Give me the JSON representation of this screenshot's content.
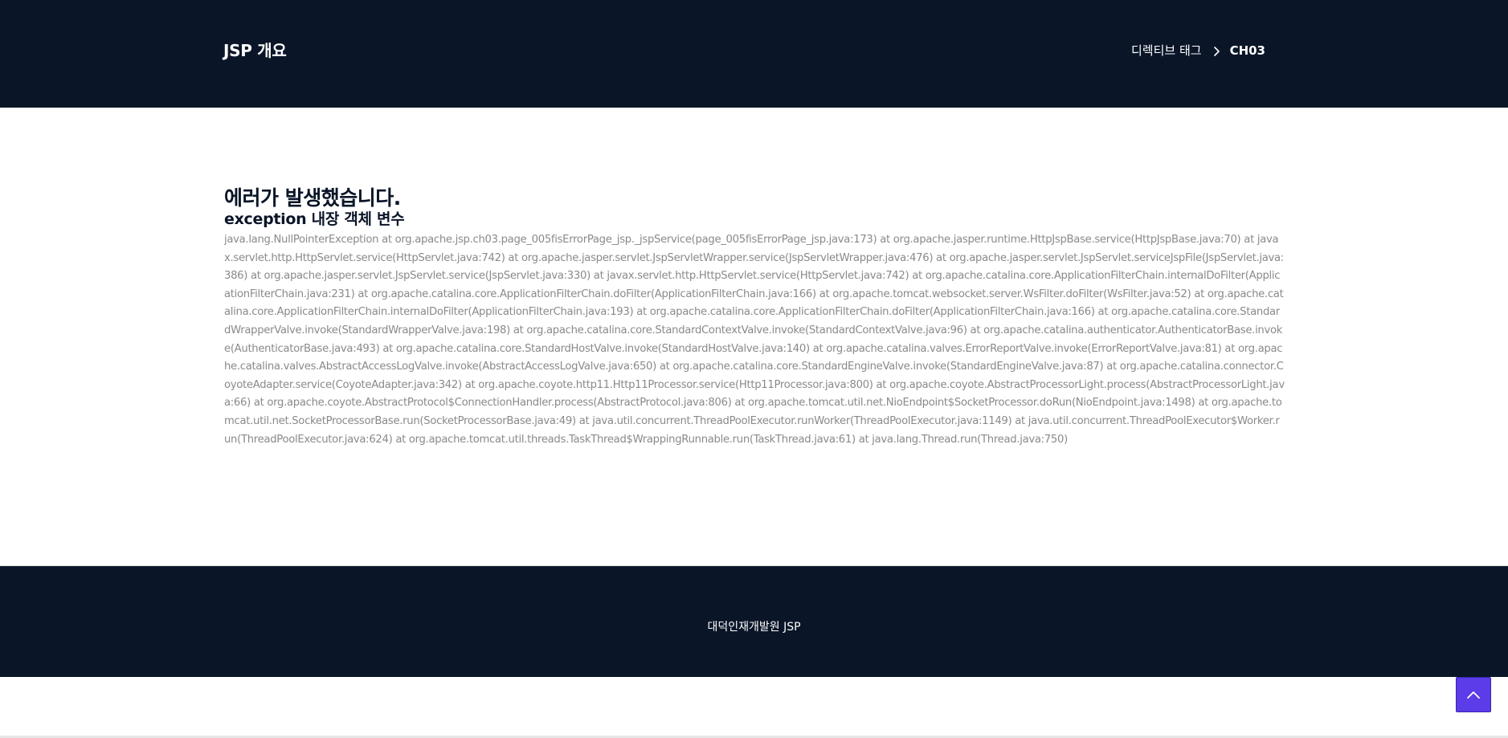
{
  "header": {
    "title": "JSP 개요",
    "breadcrumb": {
      "parent": "디렉티브 태그",
      "current": "CH03"
    }
  },
  "main": {
    "title": "에러가 발생했습니다.",
    "subtitle": "exception 내장 객체 변수",
    "stacktrace": "java.lang.NullPointerException at org.apache.jsp.ch03.page_005fisErrorPage_jsp._jspService(page_005fisErrorPage_jsp.java:173) at org.apache.jasper.runtime.HttpJspBase.service(HttpJspBase.java:70) at javax.servlet.http.HttpServlet.service(HttpServlet.java:742) at org.apache.jasper.servlet.JspServletWrapper.service(JspServletWrapper.java:476) at org.apache.jasper.servlet.JspServlet.serviceJspFile(JspServlet.java:386) at org.apache.jasper.servlet.JspServlet.service(JspServlet.java:330) at javax.servlet.http.HttpServlet.service(HttpServlet.java:742) at org.apache.catalina.core.ApplicationFilterChain.internalDoFilter(ApplicationFilterChain.java:231) at org.apache.catalina.core.ApplicationFilterChain.doFilter(ApplicationFilterChain.java:166) at org.apache.tomcat.websocket.server.WsFilter.doFilter(WsFilter.java:52) at org.apache.catalina.core.ApplicationFilterChain.internalDoFilter(ApplicationFilterChain.java:193) at org.apache.catalina.core.ApplicationFilterChain.doFilter(ApplicationFilterChain.java:166) at org.apache.catalina.core.StandardWrapperValve.invoke(StandardWrapperValve.java:198) at org.apache.catalina.core.StandardContextValve.invoke(StandardContextValve.java:96) at org.apache.catalina.authenticator.AuthenticatorBase.invoke(AuthenticatorBase.java:493) at org.apache.catalina.core.StandardHostValve.invoke(StandardHostValve.java:140) at org.apache.catalina.valves.ErrorReportValve.invoke(ErrorReportValve.java:81) at org.apache.catalina.valves.AbstractAccessLogValve.invoke(AbstractAccessLogValve.java:650) at org.apache.catalina.core.StandardEngineValve.invoke(StandardEngineValve.java:87) at org.apache.catalina.connector.CoyoteAdapter.service(CoyoteAdapter.java:342) at org.apache.coyote.http11.Http11Processor.service(Http11Processor.java:800) at org.apache.coyote.AbstractProcessorLight.process(AbstractProcessorLight.java:66) at org.apache.coyote.AbstractProtocol$ConnectionHandler.process(AbstractProtocol.java:806) at org.apache.tomcat.util.net.NioEndpoint$SocketProcessor.doRun(NioEndpoint.java:1498) at org.apache.tomcat.util.net.SocketProcessorBase.run(SocketProcessorBase.java:49) at java.util.concurrent.ThreadPoolExecutor.runWorker(ThreadPoolExecutor.java:1149) at java.util.concurrent.ThreadPoolExecutor$Worker.run(ThreadPoolExecutor.java:624) at org.apache.tomcat.util.threads.TaskThread$WrappingRunnable.run(TaskThread.java:61) at java.lang.Thread.run(Thread.java:750)"
  },
  "footer": {
    "text": "대덕인재개발원 JSP"
  },
  "icons": {
    "breadcrumb_separator": "chevron-right-icon",
    "scroll_top": "chevron-up-icon"
  },
  "colors": {
    "header_bg": "#0a1628",
    "footer_bg": "#0a1628",
    "accent": "#5b3ce8",
    "stacktrace_text": "#8a8a8a"
  }
}
